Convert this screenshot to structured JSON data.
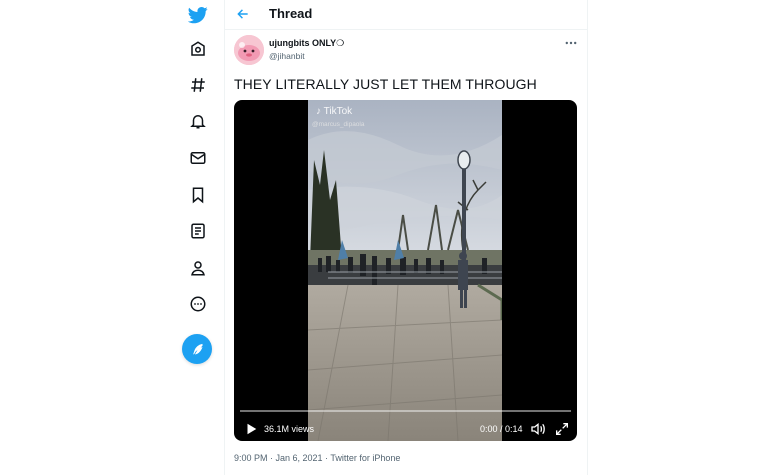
{
  "header": {
    "title": "Thread"
  },
  "tweet": {
    "author_name": "ujungbits ONLY❍",
    "author_handle": "@jihanbit",
    "text": "THEY LITERALLY JUST LET THEM THROUGH",
    "meta": "9:00 PM · Jan 6, 2021 · Twitter for iPhone"
  },
  "video": {
    "views": "36.1M views",
    "time": "0:00 / 0:14",
    "watermark_brand": "TikTok",
    "watermark_handle": "@marcus_dipaola",
    "progress": 0
  },
  "sidebar": {
    "items": [
      "twitter-logo",
      "home-icon",
      "explore-icon",
      "notifications-icon",
      "messages-icon",
      "bookmarks-icon",
      "lists-icon",
      "profile-icon",
      "more-icon"
    ]
  },
  "colors": {
    "brand": "#1da1f2",
    "text": "#0f1419",
    "secondary": "#536471"
  }
}
